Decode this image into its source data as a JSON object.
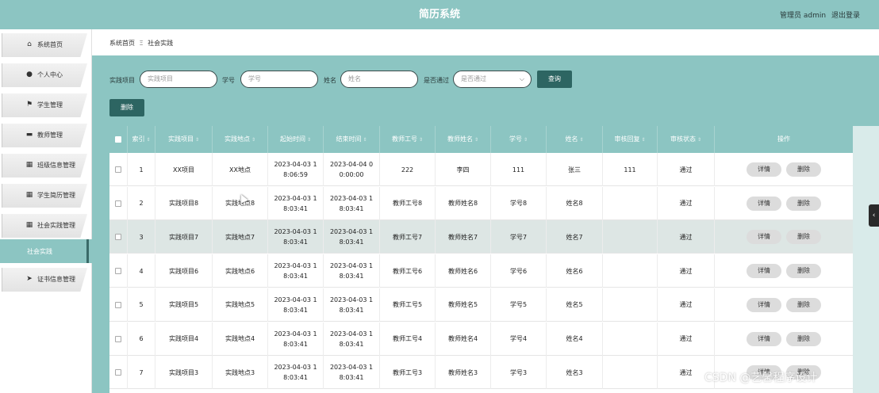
{
  "header": {
    "title": "简历系统",
    "user_label": "管理员 admin",
    "logout": "退出登录"
  },
  "sidebar": {
    "items": [
      {
        "label": "系统首页",
        "icon": "home-icon",
        "glyph": "⌂"
      },
      {
        "label": "个人中心",
        "icon": "user-icon",
        "glyph": "●"
      },
      {
        "label": "学生管理",
        "icon": "flag-icon",
        "glyph": "⚑"
      },
      {
        "label": "教师管理",
        "icon": "chat-icon",
        "glyph": "▬"
      },
      {
        "label": "班级信息管理",
        "icon": "grid-icon",
        "glyph": "▦"
      },
      {
        "label": "学生简历管理",
        "icon": "grid-icon",
        "glyph": "▦"
      },
      {
        "label": "社会实践管理",
        "icon": "grid-icon",
        "glyph": "▦"
      },
      {
        "label": "证书信息管理",
        "icon": "send-icon",
        "glyph": "➤"
      }
    ],
    "active_sub": "社会实践"
  },
  "breadcrumb": {
    "home": "系统首页",
    "sep": "Ξ",
    "current": "社会实践"
  },
  "search": {
    "project_label": "实践项目",
    "project_placeholder": "实践项目",
    "xuehao_label": "学号",
    "xuehao_placeholder": "学号",
    "name_label": "姓名",
    "name_placeholder": "姓名",
    "pass_label": "是否通过",
    "pass_placeholder": "是否通过",
    "query_button": "查询"
  },
  "toolbar": {
    "delete_button": "删除"
  },
  "table": {
    "columns": [
      "索引",
      "实践项目",
      "实践地点",
      "起始时间",
      "结束时间",
      "教师工号",
      "教师姓名",
      "学号",
      "姓名",
      "审核回复",
      "审核状态",
      "操作"
    ],
    "detail_label": "详情",
    "delete_label": "删除",
    "rows": [
      {
        "idx": "1",
        "project": "XX项目",
        "place": "XX地点",
        "start": "2023-04-03 1\n8:06:59",
        "end": "2023-04-04 0\n0:00:00",
        "tno": "222",
        "tname": "李四",
        "sno": "111",
        "sname": "张三",
        "reply": "111",
        "status": "通过"
      },
      {
        "idx": "2",
        "project": "实践项目8",
        "place": "实践地点8",
        "start": "2023-04-03 1\n8:03:41",
        "end": "2023-04-03 1\n8:03:41",
        "tno": "教师工号8",
        "tname": "教师姓名8",
        "sno": "学号8",
        "sname": "姓名8",
        "reply": "",
        "status": "通过"
      },
      {
        "idx": "3",
        "project": "实践项目7",
        "place": "实践地点7",
        "start": "2023-04-03 1\n8:03:41",
        "end": "2023-04-03 1\n8:03:41",
        "tno": "教师工号7",
        "tname": "教师姓名7",
        "sno": "学号7",
        "sname": "姓名7",
        "reply": "",
        "status": "通过"
      },
      {
        "idx": "4",
        "project": "实践项目6",
        "place": "实践地点6",
        "start": "2023-04-03 1\n8:03:41",
        "end": "2023-04-03 1\n8:03:41",
        "tno": "教师工号6",
        "tname": "教师姓名6",
        "sno": "学号6",
        "sname": "姓名6",
        "reply": "",
        "status": "通过"
      },
      {
        "idx": "5",
        "project": "实践项目5",
        "place": "实践地点5",
        "start": "2023-04-03 1\n8:03:41",
        "end": "2023-04-03 1\n8:03:41",
        "tno": "教师工号5",
        "tname": "教师姓名5",
        "sno": "学号5",
        "sname": "姓名5",
        "reply": "",
        "status": "通过"
      },
      {
        "idx": "6",
        "project": "实践项目4",
        "place": "实践地点4",
        "start": "2023-04-03 1\n8:03:41",
        "end": "2023-04-03 1\n8:03:41",
        "tno": "教师工号4",
        "tname": "教师姓名4",
        "sno": "学号4",
        "sname": "姓名4",
        "reply": "",
        "status": "通过"
      },
      {
        "idx": "7",
        "project": "实践项目3",
        "place": "实践地点3",
        "start": "2023-04-03 1\n8:03:41",
        "end": "2023-04-03 1\n8:03:41",
        "tno": "教师工号3",
        "tname": "教师姓名3",
        "sno": "学号3",
        "sname": "姓名3",
        "reply": "",
        "status": "通过"
      }
    ]
  },
  "watermark": "CSDN @艺馨程序设计",
  "colors": {
    "primary": "#8cc5c2",
    "dark": "#2d6562",
    "highlight_row": "#dde6e4"
  }
}
